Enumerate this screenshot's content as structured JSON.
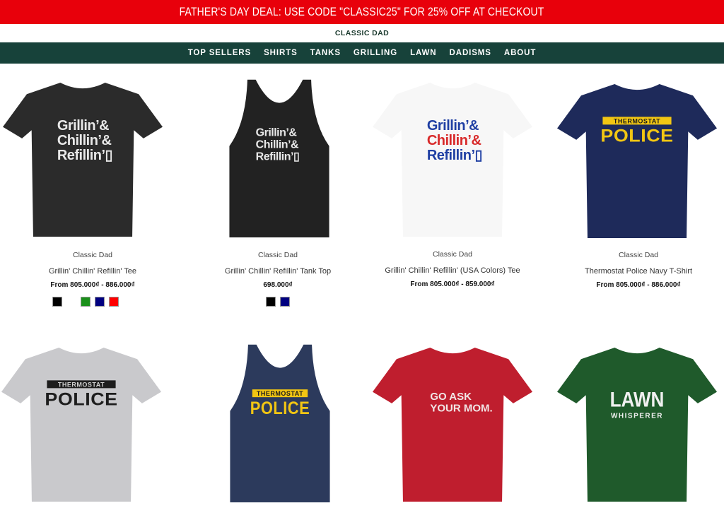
{
  "promo": {
    "text": "FATHER'S DAY DEAL: USE CODE \"CLASSIC25\" FOR 25% OFF AT CHECKOUT"
  },
  "brand": {
    "name": "CLASSIC DAD"
  },
  "nav": {
    "items": [
      "TOP SELLERS",
      "SHIRTS",
      "TANKS",
      "GRILLING",
      "LAWN",
      "DADISMS",
      "ABOUT"
    ]
  },
  "colors": {
    "promo_red": "#e8000b",
    "nav_green": "#17423a"
  },
  "products": [
    {
      "vendor": "Classic Dad",
      "title": "Grillin' Chillin' Refillin' Tee",
      "price": "From 805.000₫ - 886.000₫",
      "garment": "tee",
      "color": "#2b2b2b",
      "print": [
        "Grillin’&",
        "Chillin’&",
        "Refillin’▯"
      ],
      "swatches": [
        "#000000",
        "#ffffff",
        "#1a8f1a",
        "#000080",
        "#ff0000"
      ]
    },
    {
      "vendor": "Classic Dad",
      "title": "Grillin' Chillin' Refillin' Tank Top",
      "price": "698.000₫",
      "garment": "tank",
      "color": "#222222",
      "print": [
        "Grillin’&",
        "Chillin’&",
        "Refillin’▯"
      ],
      "swatches": [
        "#000000",
        "#000080"
      ]
    },
    {
      "vendor": "Classic Dad",
      "title": "Grillin' Chillin' Refillin' (USA Colors) Tee",
      "price": "From 805.000₫ - 859.000₫",
      "garment": "tee",
      "color": "#f7f7f7",
      "print": [
        "Grillin’&",
        "Chillin’&",
        "Refillin’▯"
      ],
      "swatches": []
    },
    {
      "vendor": "Classic Dad",
      "title": "Thermostat Police Navy T-Shirt",
      "price": "From 805.000₫ - 886.000₫",
      "garment": "tee",
      "color": "#1e2a5a",
      "print": [
        "THERMOSTAT",
        "POLICE"
      ],
      "swatches": []
    },
    {
      "garment": "tee",
      "color": "#c9c9cc",
      "print": [
        "THERMOSTAT",
        "POLICE"
      ]
    },
    {
      "garment": "tank",
      "color": "#2c3a5c",
      "print": [
        "THERMOSTAT",
        "POLICE"
      ]
    },
    {
      "garment": "tee",
      "color": "#bf1e2e",
      "print": [
        "GO ASK",
        "YOUR MOM."
      ]
    },
    {
      "garment": "tee",
      "color": "#1f5a2b",
      "print": [
        "LAWN",
        "WHISPERER"
      ]
    }
  ]
}
